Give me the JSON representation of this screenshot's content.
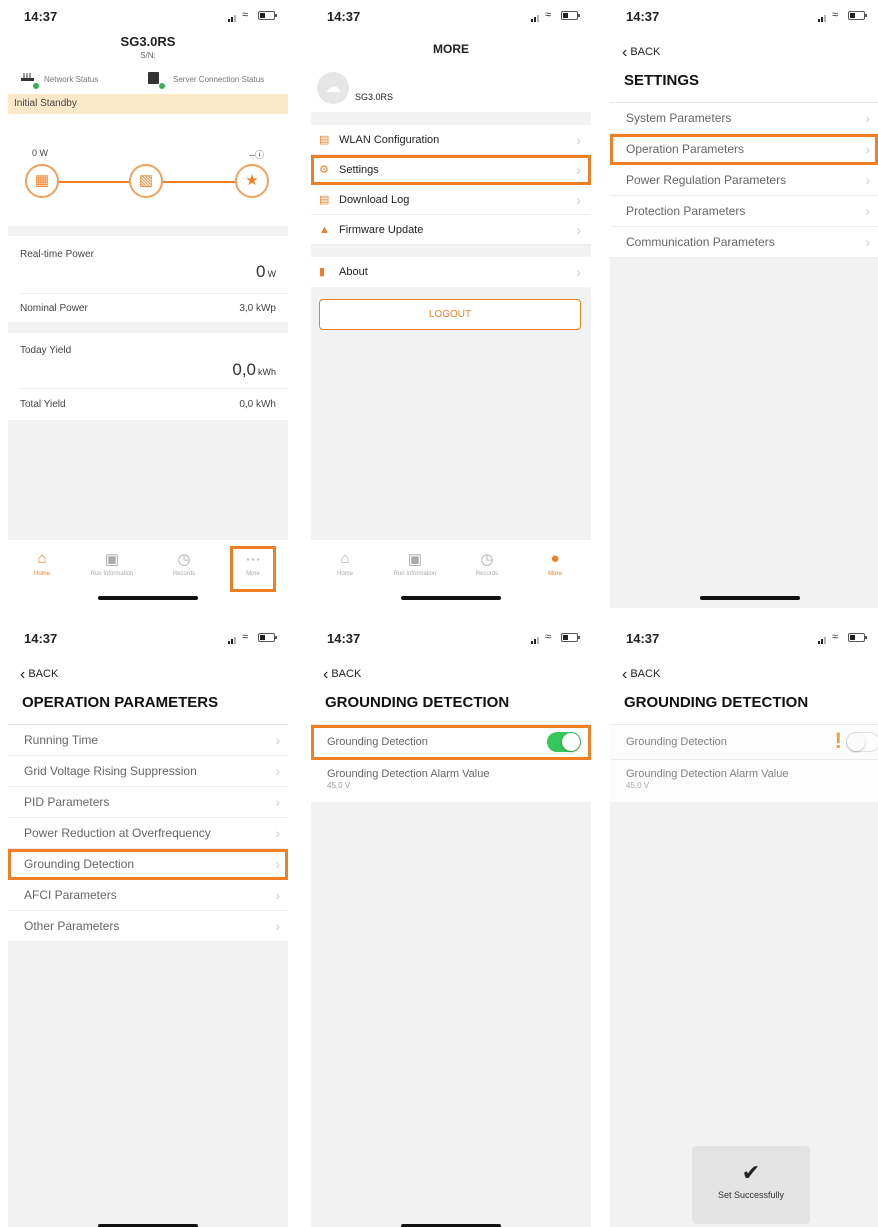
{
  "status_time": "14:37",
  "home": {
    "device_name": "SG3.0RS",
    "sn_label": "S/N:",
    "network_status": "Network Status",
    "server_status": "Server Connection Status",
    "state": "Initial Standby",
    "pv_power": "0 W",
    "grid_power": "--ⓘ",
    "realtime_label": "Real-time Power",
    "realtime_value": "0",
    "realtime_unit": "W",
    "nominal_label": "Nominal Power",
    "nominal_value": "3,0 kWp",
    "today_label": "Today Yield",
    "today_value": "0,0",
    "today_unit": "kWh",
    "total_label": "Total Yield",
    "total_value": "0,0 kWh"
  },
  "tabs": [
    "Home",
    "Run Information",
    "Records",
    "More"
  ],
  "more": {
    "title": "MORE",
    "profile_name": "SG3.0RS",
    "items": [
      "WLAN Configuration",
      "Settings",
      "Download Log",
      "Firmware Update"
    ],
    "about": "About",
    "logout": "LOGOUT"
  },
  "back_label": "BACK",
  "settings": {
    "title": "SETTINGS",
    "items": [
      "System Parameters",
      "Operation Parameters",
      "Power Regulation Parameters",
      "Protection Parameters",
      "Communication Parameters"
    ]
  },
  "operation": {
    "title": "OPERATION PARAMETERS",
    "items": [
      "Running Time",
      "Grid Voltage Rising Suppression",
      "PID Parameters",
      "Power Reduction at Overfrequency",
      "Grounding Detection",
      "AFCI  Parameters",
      "Other Parameters"
    ]
  },
  "grounding": {
    "title": "GROUNDING DETECTION",
    "toggle_label": "Grounding Detection",
    "alarm_label": "Grounding Detection Alarm Value",
    "alarm_value": "45,0 V",
    "toast": "Set Successfully"
  },
  "colors": {
    "accent": "#ef7f22",
    "toggle_on": "#35c759"
  }
}
